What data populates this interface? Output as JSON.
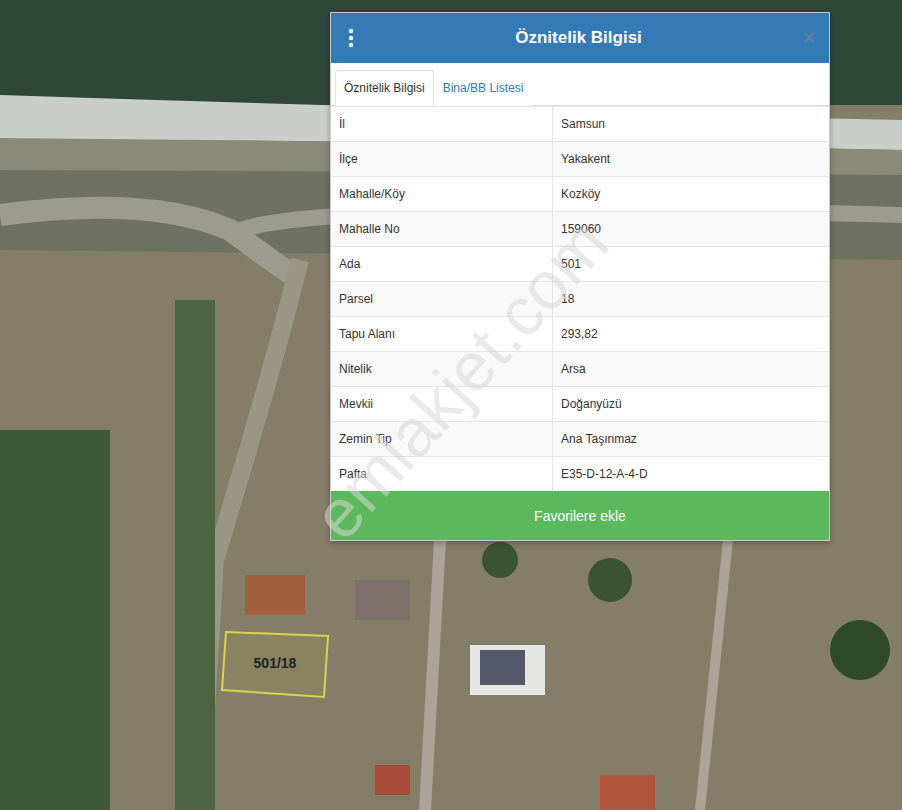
{
  "popup": {
    "title": "Öznitelik Bilgisi",
    "close_icon": "×",
    "tabs": [
      {
        "label": "Öznitelik Bilgisi",
        "selected": true
      },
      {
        "label": "Bina/BB Listesi",
        "selected": false
      }
    ],
    "rows": [
      {
        "label": "İl",
        "value": "Samsun"
      },
      {
        "label": "İlçe",
        "value": "Yakakent"
      },
      {
        "label": "Mahalle/Köy",
        "value": "Kozköy"
      },
      {
        "label": "Mahalle No",
        "value": "159060"
      },
      {
        "label": "Ada",
        "value": "501"
      },
      {
        "label": "Parsel",
        "value": "18"
      },
      {
        "label": "Tapu Alanı",
        "value": "293,82"
      },
      {
        "label": "Nitelik",
        "value": "Arsa"
      },
      {
        "label": "Mevkii",
        "value": "Doğanyüzü"
      },
      {
        "label": "Zemin Tip",
        "value": "Ana Taşınmaz"
      },
      {
        "label": "Pafta",
        "value": "E35-D-12-A-4-D"
      }
    ],
    "button": "Favorilere ekle"
  },
  "map": {
    "parcel_label": "501/18"
  },
  "watermark": "emlakjet.com"
}
